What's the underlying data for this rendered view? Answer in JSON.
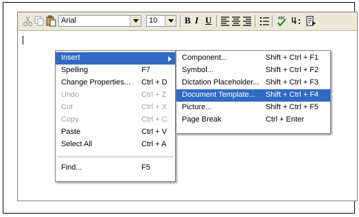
{
  "toolbar": {
    "font_name": "Arial",
    "font_size": "10",
    "bold": "B",
    "italic": "I",
    "underline": "U"
  },
  "context_menu": {
    "items": [
      {
        "label": "Insert",
        "shortcut": ""
      },
      {
        "label": "Spelling",
        "shortcut": "F7"
      },
      {
        "label": "Change Properties...",
        "shortcut": "Ctrl + D"
      },
      {
        "label": "Undo",
        "shortcut": "Ctrl + Z"
      },
      {
        "label": "Cut",
        "shortcut": "Ctrl + X"
      },
      {
        "label": "Copy",
        "shortcut": "Ctrl + C"
      },
      {
        "label": "Paste",
        "shortcut": "Ctrl + V"
      },
      {
        "label": "Select All",
        "shortcut": "Ctrl + A"
      },
      {
        "label": "Find...",
        "shortcut": "F5"
      }
    ]
  },
  "insert_submenu": {
    "items": [
      {
        "label": "Component...",
        "shortcut": "Shift + Ctrl + F1"
      },
      {
        "label": "Symbol...",
        "shortcut": "Shift + Ctrl + F2"
      },
      {
        "label": "Dictation Placeholder...",
        "shortcut": "Shift + Ctrl + F3"
      },
      {
        "label": "Document Template...",
        "shortcut": "Shift + Ctrl + F4"
      },
      {
        "label": "Picture...",
        "shortcut": "Shift + Ctrl + F5"
      },
      {
        "label": "Page Break",
        "shortcut": "Ctrl + Enter"
      }
    ]
  },
  "colors": {
    "highlight": "#316ac5",
    "toolbar_bg": "#ece9d8",
    "disabled_text": "#a0a0a0"
  }
}
